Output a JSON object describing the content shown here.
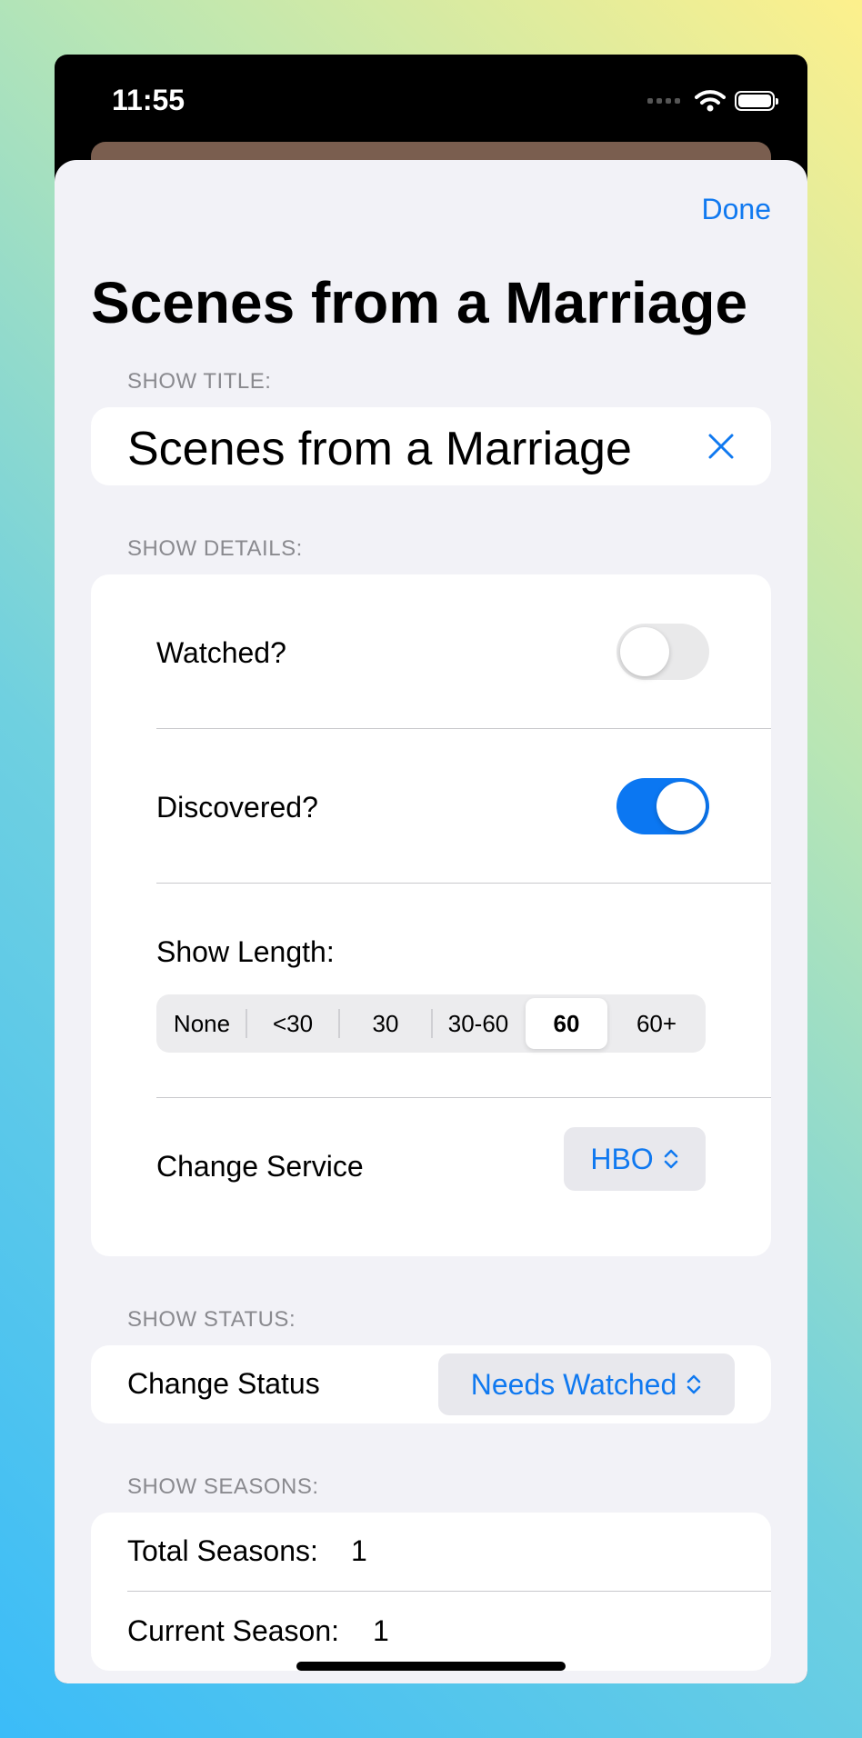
{
  "status_bar": {
    "time": "11:55"
  },
  "sheet": {
    "done_label": "Done",
    "title": "Scenes from a Marriage",
    "show_title": {
      "header": "SHOW TITLE:",
      "value": "Scenes from a Marriage"
    },
    "show_details": {
      "header": "SHOW DETAILS:",
      "watched": {
        "label": "Watched?",
        "on": false
      },
      "discovered": {
        "label": "Discovered?",
        "on": true
      },
      "show_length": {
        "label": "Show Length:",
        "options": [
          "None",
          "<30",
          "30",
          "30-60",
          "60",
          "60+"
        ],
        "selected": "60"
      },
      "service": {
        "label": "Change Service",
        "value": "HBO"
      }
    },
    "show_status": {
      "header": "SHOW STATUS:",
      "label": "Change Status",
      "value": "Needs Watched"
    },
    "show_seasons": {
      "header": "SHOW SEASONS:",
      "total_label": "Total Seasons:",
      "total_value": "1",
      "current_label": "Current Season:",
      "current_value": "1"
    }
  },
  "colors": {
    "accent": "#1079f0",
    "toggle_on": "#0b77f2",
    "background": "#f2f2f7"
  },
  "icons": [
    "wifi-icon",
    "battery-icon",
    "clear-text-icon",
    "chevron-up-down-icon"
  ]
}
